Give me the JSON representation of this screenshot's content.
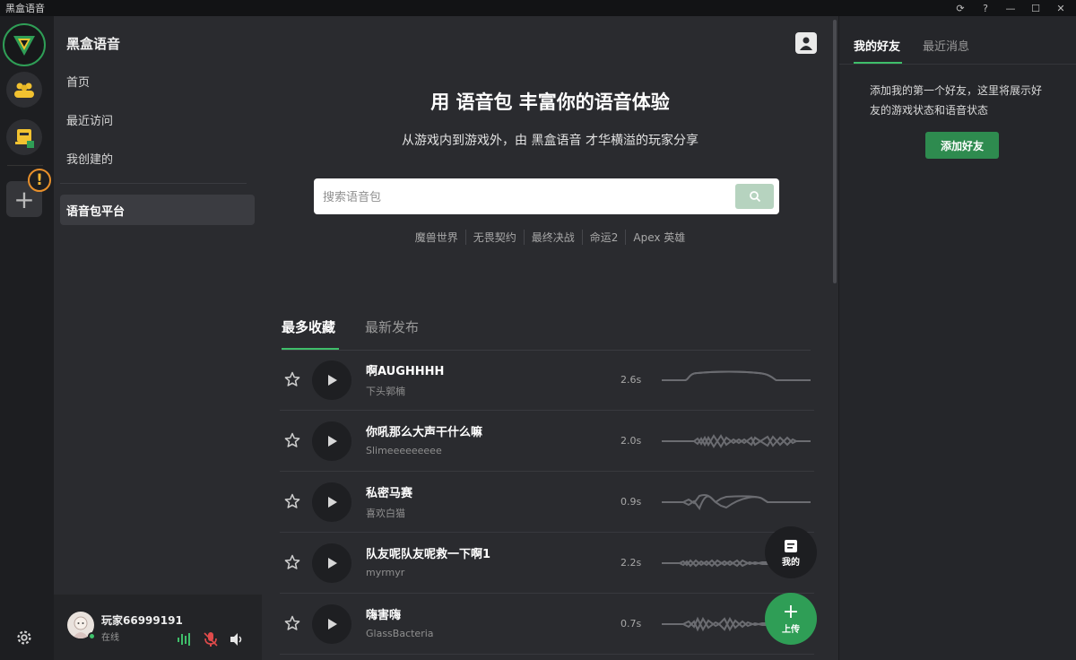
{
  "window": {
    "title": "黑盒语音"
  },
  "sidebar": {
    "title": "黑盒语音",
    "items": [
      "首页",
      "最近访问",
      "我创建的"
    ],
    "active_item": "语音包平台"
  },
  "user": {
    "name": "玩家66999191",
    "status": "在线"
  },
  "main": {
    "hero_title": "用 语音包 丰富你的语音体验",
    "hero_subtitle": "从游戏内到游戏外，由 黑盒语音 才华横溢的玩家分享",
    "search_placeholder": "搜索语音包",
    "tags": [
      "魔兽世界",
      "无畏契约",
      "最终决战",
      "命运2",
      "Apex 英雄"
    ],
    "tabs": [
      "最多收藏",
      "最新发布"
    ],
    "sounds": [
      {
        "name": "啊AUGHHHH",
        "author": "下头郭楠",
        "duration": "2.6s"
      },
      {
        "name": "你吼那么大声干什么嘛",
        "author": "Slimeeeeeeeee",
        "duration": "2.0s"
      },
      {
        "name": "私密马赛",
        "author": "喜欢白猫",
        "duration": "0.9s"
      },
      {
        "name": "队友呢队友呢救一下啊1",
        "author": "myrmyr",
        "duration": "2.2s"
      },
      {
        "name": "嗨害嗨",
        "author": "GlassBacteria",
        "duration": "0.7s"
      }
    ],
    "fab_mine": "我的",
    "fab_upload": "上传"
  },
  "right": {
    "tabs": [
      "我的好友",
      "最近消息"
    ],
    "hint": "添加我的第一个好友，这里将展示好友的游戏状态和语音状态",
    "add_button": "添加好友"
  },
  "colors": {
    "accent": "#3fbe6a",
    "button_green": "#2e8b4f",
    "warning": "#f7b733"
  }
}
